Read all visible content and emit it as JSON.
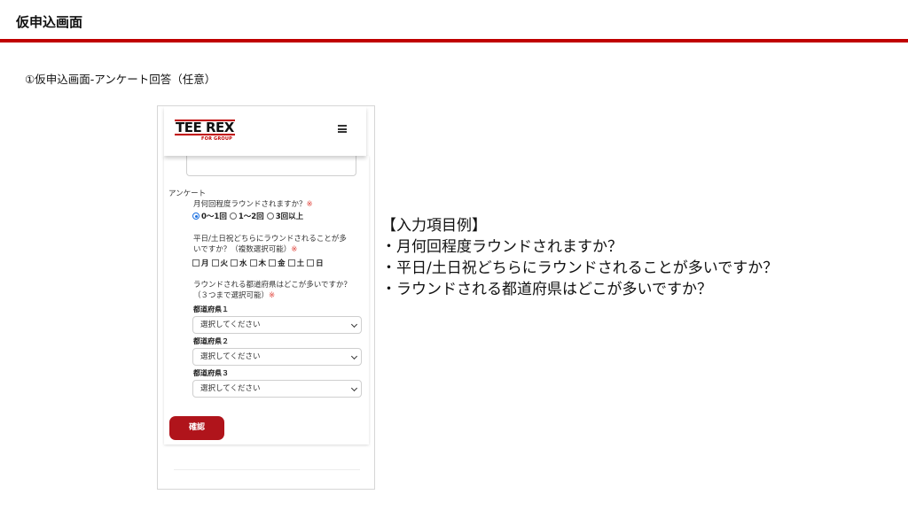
{
  "slide": {
    "title": "仮申込画面",
    "subtitle": "①仮申込画面-アンケート回答（任意）"
  },
  "phone": {
    "logo_main": "TEE REX",
    "logo_sub": "FOR GROUP",
    "menu_icon": "hamburger-icon",
    "section_label": "アンケート",
    "q1": {
      "text": "月何回程度ラウンドされますか？",
      "required_mark": "※"
    },
    "q1_options": [
      {
        "label": "0〜1回",
        "selected": true
      },
      {
        "label": "1〜2回",
        "selected": false
      },
      {
        "label": "3回以上",
        "selected": false
      }
    ],
    "q2": {
      "line1": "平日/土日祝どちらにラウンドされることが多",
      "line2": "いですか？（複数選択可能）",
      "required_mark": "※"
    },
    "q2_options": [
      "月",
      "火",
      "水",
      "木",
      "金",
      "土",
      "日"
    ],
    "q3": {
      "line1": "ラウンドされる都道府県はどこが多いですか？",
      "line2": "（３つまで選択可能）",
      "required_mark": "※"
    },
    "prefs": [
      {
        "label": "都道府県１",
        "value": "選択してください"
      },
      {
        "label": "都道府県２",
        "value": "選択してください"
      },
      {
        "label": "都道府県３",
        "value": "選択してください"
      }
    ],
    "confirm_label": "確認",
    "accent_color": "#b0141b"
  },
  "example": {
    "heading": "【入力項目例】",
    "items": [
      "・月何回程度ラウンドされますか？",
      "・平日/土日祝どちらにラウンドされることが多いですか？",
      "・ラウンドされる都道府県はどこが多いですか？"
    ]
  }
}
